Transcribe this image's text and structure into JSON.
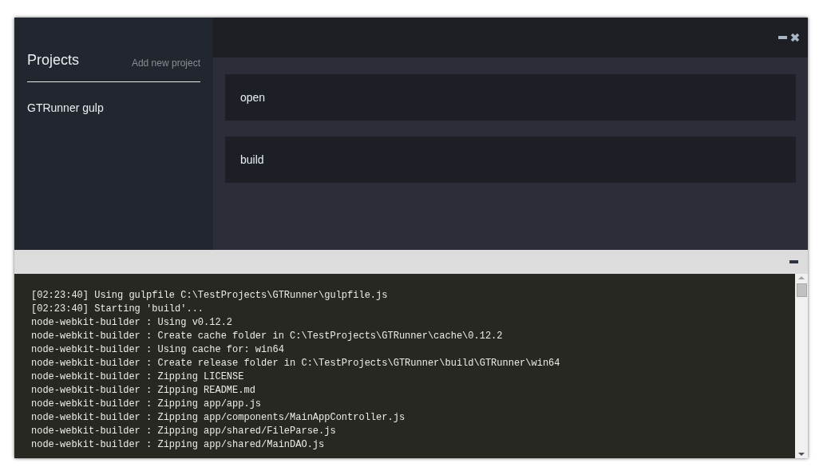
{
  "sidebar": {
    "title": "Projects",
    "add_link": "Add new project",
    "items": [
      {
        "label": "GTRunner gulp"
      }
    ]
  },
  "tasks": [
    {
      "label": "open"
    },
    {
      "label": "build"
    }
  ],
  "console": {
    "lines": [
      "[02:23:40] Using gulpfile C:\\TestProjects\\GTRunner\\gulpfile.js",
      "[02:23:40] Starting 'build'...",
      "node-webkit-builder : Using v0.12.2",
      "node-webkit-builder : Create cache folder in C:\\TestProjects\\GTRunner\\cache\\0.12.2",
      "node-webkit-builder : Using cache for: win64",
      "node-webkit-builder : Create release folder in C:\\TestProjects\\GTRunner\\build\\GTRunner\\win64",
      "node-webkit-builder : Zipping LICENSE",
      "node-webkit-builder : Zipping README.md",
      "node-webkit-builder : Zipping app/app.js",
      "node-webkit-builder : Zipping app/components/MainAppController.js",
      "node-webkit-builder : Zipping app/shared/FileParse.js",
      "node-webkit-builder : Zipping app/shared/MainDAO.js"
    ]
  }
}
